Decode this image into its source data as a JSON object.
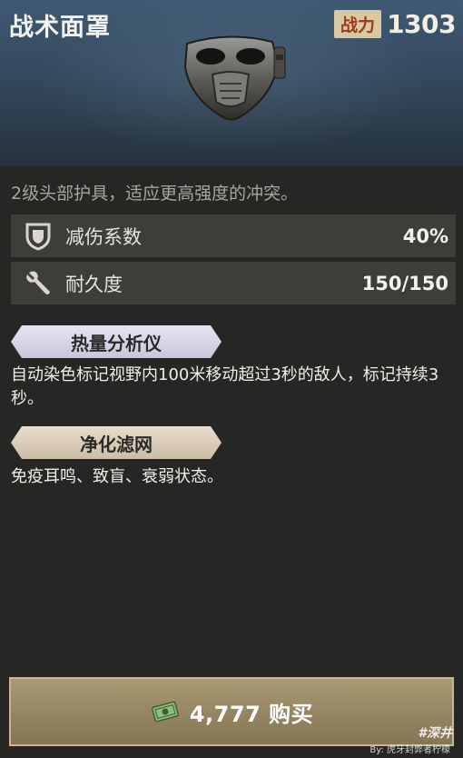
{
  "item": {
    "title": "战术面罩",
    "power_label": "战力",
    "power_value": "1303",
    "description": "2级头部护具，适应更高强度的冲突。"
  },
  "stats": [
    {
      "icon": "shield-icon",
      "label": "减伤系数",
      "value": "40%"
    },
    {
      "icon": "wrench-icon",
      "label": "耐久度",
      "value": "150/150"
    }
  ],
  "mods": [
    {
      "name": "热量分析仪",
      "text": "自动染色标记视野内100米移动超过3秒的敌人，标记持续3秒。"
    },
    {
      "name": "净化滤网",
      "text": "免疫耳鸣、致盲、衰弱状态。"
    }
  ],
  "buy": {
    "icon": "cash-icon",
    "label": "4,777 购买"
  },
  "watermark": {
    "logo": "#深井",
    "credit": "By: 虎牙封弊者柠檬"
  },
  "colors": {
    "header": "#34495d",
    "background": "#262624",
    "stat_row": "#3e3d3a",
    "buy_button": "#948462",
    "power_badge": "#d9c9a3"
  }
}
